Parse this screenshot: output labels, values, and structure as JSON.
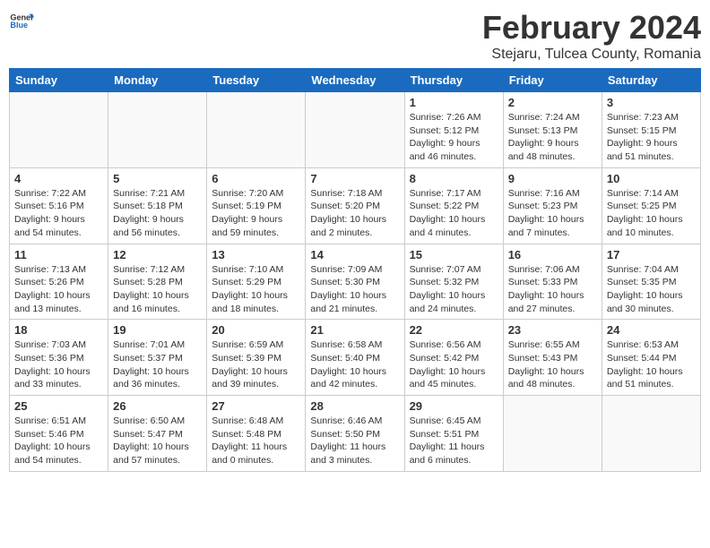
{
  "header": {
    "logo_general": "General",
    "logo_blue": "Blue",
    "month": "February 2024",
    "location": "Stejaru, Tulcea County, Romania"
  },
  "days_of_week": [
    "Sunday",
    "Monday",
    "Tuesday",
    "Wednesday",
    "Thursday",
    "Friday",
    "Saturday"
  ],
  "weeks": [
    [
      {
        "day": "",
        "info": ""
      },
      {
        "day": "",
        "info": ""
      },
      {
        "day": "",
        "info": ""
      },
      {
        "day": "",
        "info": ""
      },
      {
        "day": "1",
        "info": "Sunrise: 7:26 AM\nSunset: 5:12 PM\nDaylight: 9 hours\nand 46 minutes."
      },
      {
        "day": "2",
        "info": "Sunrise: 7:24 AM\nSunset: 5:13 PM\nDaylight: 9 hours\nand 48 minutes."
      },
      {
        "day": "3",
        "info": "Sunrise: 7:23 AM\nSunset: 5:15 PM\nDaylight: 9 hours\nand 51 minutes."
      }
    ],
    [
      {
        "day": "4",
        "info": "Sunrise: 7:22 AM\nSunset: 5:16 PM\nDaylight: 9 hours\nand 54 minutes."
      },
      {
        "day": "5",
        "info": "Sunrise: 7:21 AM\nSunset: 5:18 PM\nDaylight: 9 hours\nand 56 minutes."
      },
      {
        "day": "6",
        "info": "Sunrise: 7:20 AM\nSunset: 5:19 PM\nDaylight: 9 hours\nand 59 minutes."
      },
      {
        "day": "7",
        "info": "Sunrise: 7:18 AM\nSunset: 5:20 PM\nDaylight: 10 hours\nand 2 minutes."
      },
      {
        "day": "8",
        "info": "Sunrise: 7:17 AM\nSunset: 5:22 PM\nDaylight: 10 hours\nand 4 minutes."
      },
      {
        "day": "9",
        "info": "Sunrise: 7:16 AM\nSunset: 5:23 PM\nDaylight: 10 hours\nand 7 minutes."
      },
      {
        "day": "10",
        "info": "Sunrise: 7:14 AM\nSunset: 5:25 PM\nDaylight: 10 hours\nand 10 minutes."
      }
    ],
    [
      {
        "day": "11",
        "info": "Sunrise: 7:13 AM\nSunset: 5:26 PM\nDaylight: 10 hours\nand 13 minutes."
      },
      {
        "day": "12",
        "info": "Sunrise: 7:12 AM\nSunset: 5:28 PM\nDaylight: 10 hours\nand 16 minutes."
      },
      {
        "day": "13",
        "info": "Sunrise: 7:10 AM\nSunset: 5:29 PM\nDaylight: 10 hours\nand 18 minutes."
      },
      {
        "day": "14",
        "info": "Sunrise: 7:09 AM\nSunset: 5:30 PM\nDaylight: 10 hours\nand 21 minutes."
      },
      {
        "day": "15",
        "info": "Sunrise: 7:07 AM\nSunset: 5:32 PM\nDaylight: 10 hours\nand 24 minutes."
      },
      {
        "day": "16",
        "info": "Sunrise: 7:06 AM\nSunset: 5:33 PM\nDaylight: 10 hours\nand 27 minutes."
      },
      {
        "day": "17",
        "info": "Sunrise: 7:04 AM\nSunset: 5:35 PM\nDaylight: 10 hours\nand 30 minutes."
      }
    ],
    [
      {
        "day": "18",
        "info": "Sunrise: 7:03 AM\nSunset: 5:36 PM\nDaylight: 10 hours\nand 33 minutes."
      },
      {
        "day": "19",
        "info": "Sunrise: 7:01 AM\nSunset: 5:37 PM\nDaylight: 10 hours\nand 36 minutes."
      },
      {
        "day": "20",
        "info": "Sunrise: 6:59 AM\nSunset: 5:39 PM\nDaylight: 10 hours\nand 39 minutes."
      },
      {
        "day": "21",
        "info": "Sunrise: 6:58 AM\nSunset: 5:40 PM\nDaylight: 10 hours\nand 42 minutes."
      },
      {
        "day": "22",
        "info": "Sunrise: 6:56 AM\nSunset: 5:42 PM\nDaylight: 10 hours\nand 45 minutes."
      },
      {
        "day": "23",
        "info": "Sunrise: 6:55 AM\nSunset: 5:43 PM\nDaylight: 10 hours\nand 48 minutes."
      },
      {
        "day": "24",
        "info": "Sunrise: 6:53 AM\nSunset: 5:44 PM\nDaylight: 10 hours\nand 51 minutes."
      }
    ],
    [
      {
        "day": "25",
        "info": "Sunrise: 6:51 AM\nSunset: 5:46 PM\nDaylight: 10 hours\nand 54 minutes."
      },
      {
        "day": "26",
        "info": "Sunrise: 6:50 AM\nSunset: 5:47 PM\nDaylight: 10 hours\nand 57 minutes."
      },
      {
        "day": "27",
        "info": "Sunrise: 6:48 AM\nSunset: 5:48 PM\nDaylight: 11 hours\nand 0 minutes."
      },
      {
        "day": "28",
        "info": "Sunrise: 6:46 AM\nSunset: 5:50 PM\nDaylight: 11 hours\nand 3 minutes."
      },
      {
        "day": "29",
        "info": "Sunrise: 6:45 AM\nSunset: 5:51 PM\nDaylight: 11 hours\nand 6 minutes."
      },
      {
        "day": "",
        "info": ""
      },
      {
        "day": "",
        "info": ""
      }
    ]
  ]
}
